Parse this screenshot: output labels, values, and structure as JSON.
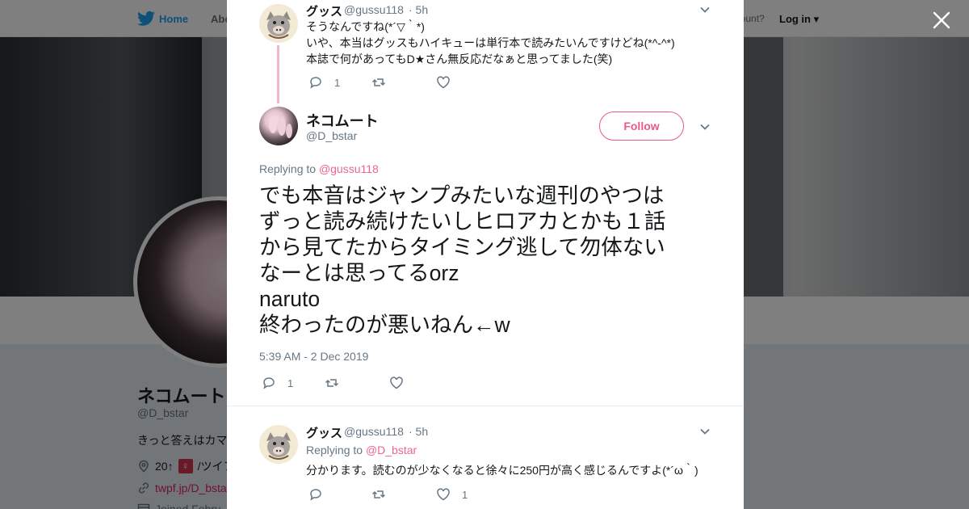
{
  "background": {
    "nav": {
      "home": "Home",
      "about": "Abo",
      "account_text": "account?",
      "login": "Log in"
    },
    "profile": {
      "name": "ネコムート",
      "handle": "@D_bstar",
      "bio": "きっと答えはカマ",
      "location_prefix": "20↑",
      "location_suffix": "/ツイフ",
      "gender_symbol": "♀",
      "url": "twpf.jp/D_bsta",
      "joined": "Joined Febru"
    }
  },
  "modal": {
    "parent": {
      "name": "グッス",
      "handle": "@gussu118",
      "time": "· 5h",
      "lines": [
        "そうなんですね(*´▽｀*)",
        "いや、本当はグッスもハイキューは単行本で読みたいんですけどね(*^-^*)",
        "本誌で何があってもD★さん無反応だなぁと思ってました(笑)"
      ],
      "reply_count": "1",
      "retweet_count": "",
      "like_count": ""
    },
    "main": {
      "name": "ネコムート",
      "handle": "@D_bstar",
      "follow_label": "Follow",
      "replying_to_label": "Replying to",
      "replying_to_handle": "@gussu118",
      "text": "でも本音はジャンプみたいな週刊のやつは\nずっと読み続けたいしヒロアカとかも１話\nから見てたからタイミング逃して勿体ない\nなーとは思ってるorz\nnaruto\n終わったのが悪いねん←w",
      "timestamp": "5:39 AM - 2 Dec 2019",
      "reply_count": "1",
      "retweet_count": "",
      "like_count": ""
    },
    "reply": {
      "name": "グッス",
      "handle": "@gussu118",
      "time": "· 5h",
      "replying_to_label": "Replying to",
      "replying_to_handle": "@D_bstar",
      "text": "分かります。読むのが少なくなると徐々に250円が高く感じるんですよ(*´ω｀)",
      "reply_count": "",
      "retweet_count": "",
      "like_count": "1"
    }
  },
  "colors": {
    "accent": "#e0245e",
    "twitter_blue": "#1da1f2",
    "muted": "#657786"
  },
  "icons": [
    "twitter-bird-icon",
    "close-icon",
    "chevron-down-icon",
    "reply-icon",
    "retweet-icon",
    "like-icon",
    "location-icon",
    "link-icon",
    "calendar-icon"
  ]
}
